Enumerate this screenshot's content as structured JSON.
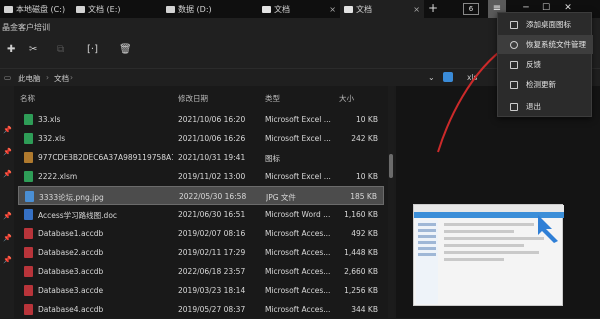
{
  "tabs": [
    {
      "label": "本地磁盘 (C:)"
    },
    {
      "label": "文档 (E:)"
    },
    {
      "label": "数据 (D:)"
    },
    {
      "label": "文档"
    },
    {
      "label": "文档"
    }
  ],
  "tab_close": "×",
  "add_tab": "+",
  "tab_count": "6",
  "window": {
    "menu": "≡",
    "minimize": "─",
    "maximize": "☐",
    "close": "✕"
  },
  "ribbon_title": "晶金客户培训",
  "toolbar_icons": {
    "cut": "✂",
    "copy": "⧉",
    "rename": "[·]",
    "delete": "🗑"
  },
  "breadcrumb": {
    "root": "此电脑",
    "sep": "›",
    "folder": "文档",
    "sep2": "›"
  },
  "search": {
    "dropdown": "⌄",
    "text": "xls"
  },
  "columns": {
    "name": "名称",
    "date": "修改日期",
    "type": "类型",
    "size": "大小"
  },
  "files": [
    {
      "name": "33.xls",
      "date": "2021/10/06 16:20",
      "type": "Microsoft Excel ...",
      "size": "10 KB",
      "color": "#2e9d57"
    },
    {
      "name": "332.xls",
      "date": "2021/10/06 16:26",
      "type": "Microsoft Excel ...",
      "size": "242 KB",
      "color": "#2e9d57"
    },
    {
      "name": "977CDE3B2DEC6A37A989119758A1...",
      "date": "2021/10/31 19:41",
      "type": "图标",
      "size": "",
      "color": "#b07a2e"
    },
    {
      "name": "2222.xlsm",
      "date": "2019/11/02 13:00",
      "type": "Microsoft Excel ...",
      "size": "10 KB",
      "color": "#2e9d57"
    },
    {
      "name": "3333论坛.png.jpg",
      "date": "2022/05/30 16:58",
      "type": "JPG 文件",
      "size": "185 KB",
      "color": "#4a8fd4"
    },
    {
      "name": "Access学习路线图.doc",
      "date": "2021/06/30 16:51",
      "type": "Microsoft Word ...",
      "size": "1,160 KB",
      "color": "#3570c4"
    },
    {
      "name": "Database1.accdb",
      "date": "2019/02/07 08:16",
      "type": "Microsoft Acces...",
      "size": "492 KB",
      "color": "#b8343a"
    },
    {
      "name": "Database2.accdb",
      "date": "2019/02/11 17:29",
      "type": "Microsoft Acces...",
      "size": "1,448 KB",
      "color": "#b8343a"
    },
    {
      "name": "Database3.accdb",
      "date": "2022/06/18 23:57",
      "type": "Microsoft Acces...",
      "size": "2,660 KB",
      "color": "#b8343a"
    },
    {
      "name": "Database3.accde",
      "date": "2019/03/23 18:14",
      "type": "Microsoft Acces...",
      "size": "1,256 KB",
      "color": "#b8343a"
    },
    {
      "name": "Database4.accdb",
      "date": "2019/05/27 08:37",
      "type": "Microsoft Acces...",
      "size": "344 KB",
      "color": "#b8343a"
    }
  ],
  "selected_file": "3333论坛.png.jpg",
  "menu": [
    {
      "label": "添加桌面图标"
    },
    {
      "label": "恢复系统文件管理"
    },
    {
      "label": "反馈"
    },
    {
      "label": "检测更新"
    },
    {
      "label": "退出"
    }
  ],
  "arrow_color": "#cc2a2a"
}
